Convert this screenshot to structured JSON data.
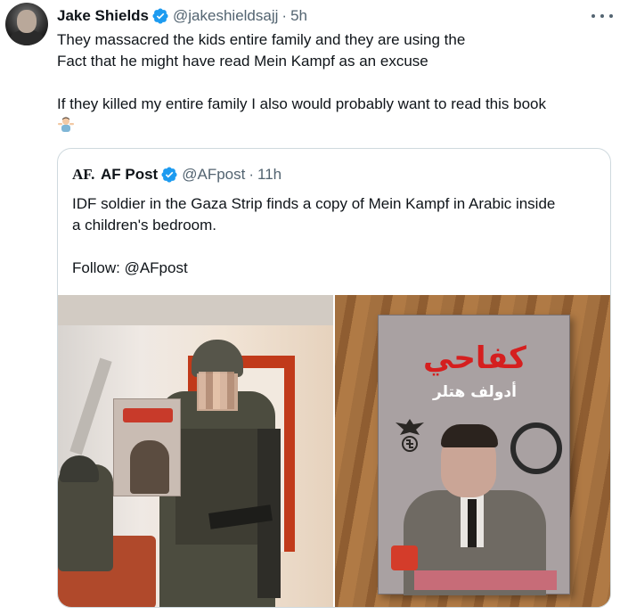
{
  "tweet": {
    "author_name": "Jake Shields",
    "author_handle": "@jakeshieldsajj",
    "separator": "·",
    "time": "5h",
    "line1": "They massacred the kids entire family and they are using the",
    "line2": "Fact that he might have read Mein Kampf as an excuse",
    "line3": "If they killed my entire family I also would probably want to read this book",
    "emoji": "person-shrugging-emoji",
    "icons": {
      "verified": "verified-badge-icon",
      "more": "more-options-icon"
    },
    "colors": {
      "verified": "#1d9bf0",
      "secondary_text": "#536471"
    }
  },
  "quote": {
    "logo_text": "AF.",
    "author_name": "AF Post",
    "author_handle": "@AFpost",
    "separator": "·",
    "time": "11h",
    "line1": "IDF soldier in the Gaza Strip finds a copy of Mein Kampf in Arabic inside",
    "line2": "a children's bedroom.",
    "line3": "Follow: @AFpost",
    "media": {
      "left_image": "soldier-holding-book-photo",
      "right_image": "book-cover-photo",
      "book_title": "كفاحي",
      "book_author": "أدولف هتلر"
    }
  }
}
